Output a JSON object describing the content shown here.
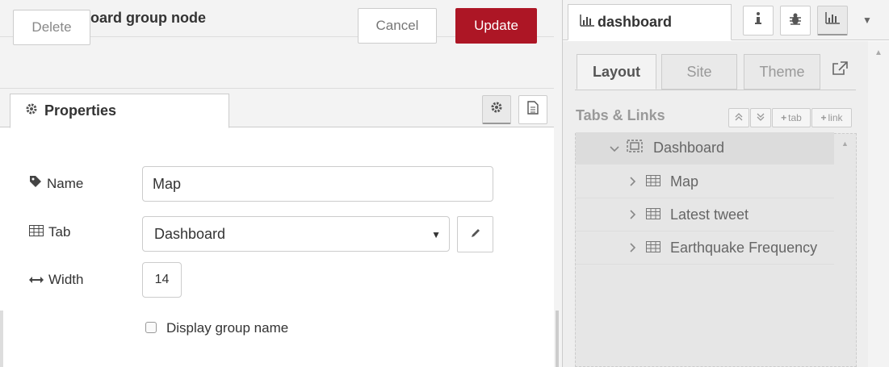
{
  "tray": {
    "title": "Edit dashboard group node",
    "delete_label": "Delete",
    "cancel_label": "Cancel",
    "update_label": "Update",
    "properties_tab": "Properties",
    "fields": {
      "name_label": "Name",
      "name_value": "Map",
      "tab_label": "Tab",
      "tab_value": "Dashboard",
      "width_label": "Width",
      "width_value": "14",
      "display_group_name_label": "Display group name",
      "display_group_name_checked": false
    }
  },
  "sidebar": {
    "active_tab": "dashboard",
    "sub_tabs": [
      "Layout",
      "Site",
      "Theme"
    ],
    "section_heading": "Tabs & Links",
    "add_tab_label": "tab",
    "add_link_label": "link",
    "tree": [
      {
        "label": "Dashboard",
        "type": "tab",
        "expanded": true
      },
      {
        "label": "Map",
        "type": "group"
      },
      {
        "label": "Latest tweet",
        "type": "group"
      },
      {
        "label": "Earthquake Frequency",
        "type": "group"
      }
    ]
  },
  "colors": {
    "update_button": "#ad1625",
    "panel_background": "#f3f3f3"
  }
}
